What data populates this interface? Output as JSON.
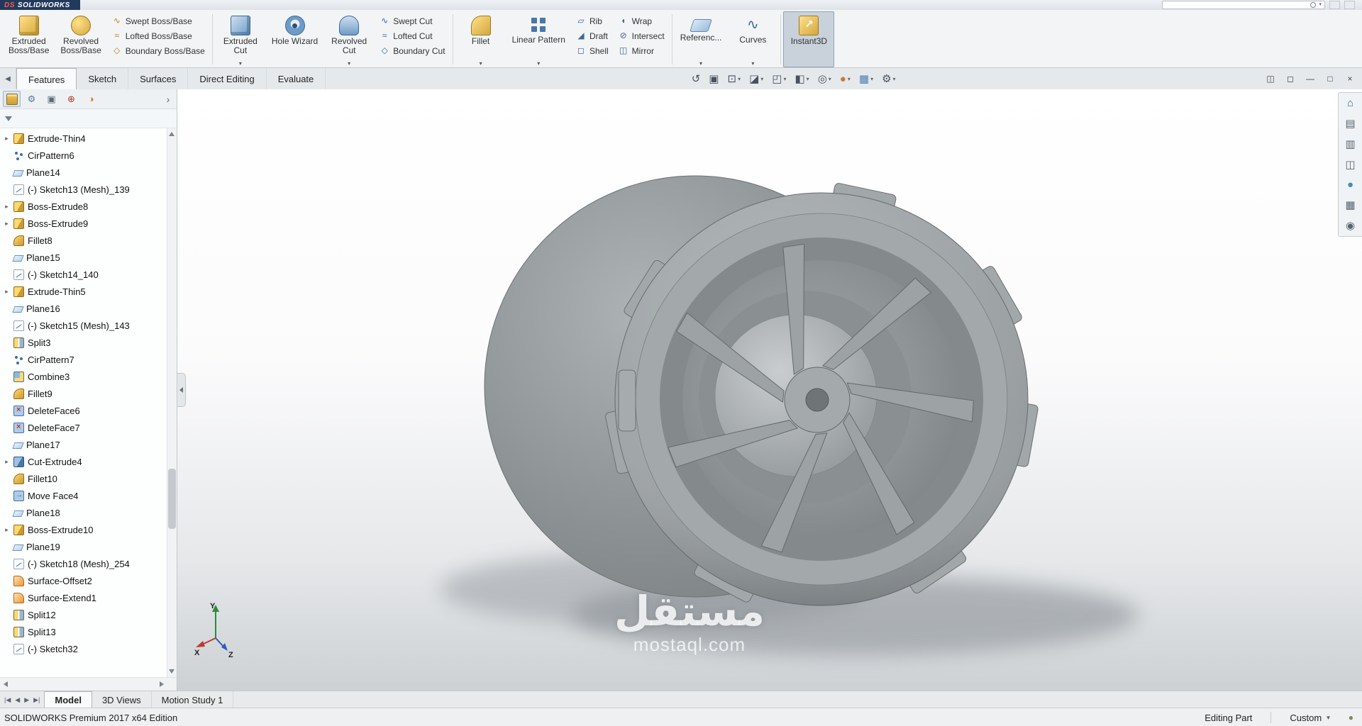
{
  "titlebar": {
    "logo_mark": "DS",
    "app_name": "SOLIDWORKS"
  },
  "glyphs": {
    "caret_down": "▾",
    "chevron_right": "›",
    "tree_expand": "▸"
  },
  "ribbon": {
    "groups": [
      {
        "buttons": [
          {
            "type": "large",
            "label": "Extruded\nBoss/Base",
            "icon": "extruded-boss"
          },
          {
            "type": "large",
            "label": "Revolved\nBoss/Base",
            "icon": "revolved-boss"
          },
          {
            "type": "stack",
            "items": [
              {
                "label": "Swept Boss/Base",
                "icon": "swept-boss"
              },
              {
                "label": "Lofted Boss/Base",
                "icon": "lofted-boss"
              },
              {
                "label": "Boundary Boss/Base",
                "icon": "boundary-boss"
              }
            ]
          }
        ]
      },
      {
        "buttons": [
          {
            "type": "large",
            "label": "Extruded\nCut",
            "icon": "extruded-cut",
            "dropdown": true
          },
          {
            "type": "large",
            "label": "Hole Wizard",
            "icon": "hole-wizard"
          },
          {
            "type": "large",
            "label": "Revolved\nCut",
            "icon": "revolved-cut",
            "dropdown": true
          },
          {
            "type": "stack",
            "items": [
              {
                "label": "Swept Cut",
                "icon": "swept-cut"
              },
              {
                "label": "Lofted Cut",
                "icon": "lofted-cut"
              },
              {
                "label": "Boundary Cut",
                "icon": "boundary-cut"
              }
            ]
          }
        ]
      },
      {
        "buttons": [
          {
            "type": "large",
            "label": "Fillet",
            "icon": "fillet",
            "dropdown": true
          },
          {
            "type": "large",
            "label": "Linear Pattern",
            "icon": "linear-pattern",
            "dropdown": true
          },
          {
            "type": "stack",
            "items": [
              {
                "label": "Rib",
                "icon": "rib"
              },
              {
                "label": "Draft",
                "icon": "draft"
              },
              {
                "label": "Shell",
                "icon": "shell"
              }
            ]
          },
          {
            "type": "stack",
            "items": [
              {
                "label": "Wrap",
                "icon": "wrap"
              },
              {
                "label": "Intersect",
                "icon": "intersect"
              },
              {
                "label": "Mirror",
                "icon": "mirror"
              }
            ]
          }
        ]
      },
      {
        "buttons": [
          {
            "type": "large",
            "label": "Referenc...",
            "icon": "reference",
            "dropdown": true
          },
          {
            "type": "large",
            "label": "Curves",
            "icon": "curves",
            "dropdown": true
          }
        ]
      },
      {
        "buttons": [
          {
            "type": "large",
            "label": "Instant3D",
            "icon": "instant3d",
            "active": true
          }
        ]
      }
    ]
  },
  "tabbar": {
    "back_glyph": "◀",
    "tabs": [
      "Features",
      "Sketch",
      "Surfaces",
      "Direct Editing",
      "Evaluate"
    ],
    "active_index": 0
  },
  "view_toolbar": {
    "icons": [
      {
        "name": "previous-view",
        "glyph": "↺"
      },
      {
        "name": "zoom-to-fit",
        "glyph": "▣"
      },
      {
        "name": "zoom-to-area",
        "glyph": "⊡",
        "dropdown": true
      },
      {
        "name": "section-view",
        "glyph": "◪",
        "dropdown": true
      },
      {
        "name": "view-orientation",
        "glyph": "◰",
        "dropdown": true
      },
      {
        "name": "display-style",
        "glyph": "◧",
        "dropdown": true
      },
      {
        "name": "hide-show-items",
        "glyph": "◎",
        "dropdown": true
      },
      {
        "name": "edit-appearance",
        "glyph": "●",
        "tint": "#c77b3a",
        "dropdown": true
      },
      {
        "name": "apply-scene",
        "glyph": "▦",
        "tint": "#4a7ab5",
        "dropdown": true
      },
      {
        "name": "view-settings",
        "glyph": "⚙",
        "dropdown": true
      }
    ]
  },
  "window_controls": {
    "buttons": [
      {
        "name": "task-pane-toggle",
        "glyph": "◫"
      },
      {
        "name": "display-pane-toggle",
        "glyph": "◻"
      },
      {
        "name": "minimize-button",
        "glyph": "—"
      },
      {
        "name": "restore-button",
        "glyph": "□"
      },
      {
        "name": "close-button",
        "glyph": "×"
      }
    ]
  },
  "left_panel": {
    "tabs": [
      {
        "name": "featuremanager-tab"
      },
      {
        "name": "propertymanager-tab",
        "glyph": "⚙",
        "color": "#5a7a9a"
      },
      {
        "name": "configurationmanager-tab",
        "glyph": "▣",
        "color": "#5a6a78"
      },
      {
        "name": "dimxpertmanager-tab",
        "glyph": "⊕",
        "color": "#b03a2e"
      },
      {
        "name": "displaymanager-tab",
        "glyph": "◑",
        "color": "#d07a28"
      }
    ],
    "tree": [
      {
        "label": "Extrude-Thin4",
        "icon": "extrude",
        "expand": true
      },
      {
        "label": "CirPattern6",
        "icon": "cirpattern"
      },
      {
        "label": "Plane14",
        "icon": "plane"
      },
      {
        "label": "(-) Sketch13 (Mesh)_139",
        "icon": "sketch"
      },
      {
        "label": "Boss-Extrude8",
        "icon": "extrude",
        "expand": true
      },
      {
        "label": "Boss-Extrude9",
        "icon": "extrude",
        "expand": true
      },
      {
        "label": "Fillet8",
        "icon": "fillet"
      },
      {
        "label": "Plane15",
        "icon": "plane"
      },
      {
        "label": "(-) Sketch14_140",
        "icon": "sketch"
      },
      {
        "label": "Extrude-Thin5",
        "icon": "extrude",
        "expand": true
      },
      {
        "label": "Plane16",
        "icon": "plane"
      },
      {
        "label": "(-) Sketch15 (Mesh)_143",
        "icon": "sketch"
      },
      {
        "label": "Split3",
        "icon": "split"
      },
      {
        "label": "CirPattern7",
        "icon": "cirpattern"
      },
      {
        "label": "Combine3",
        "icon": "combine"
      },
      {
        "label": "Fillet9",
        "icon": "fillet"
      },
      {
        "label": "DeleteFace6",
        "icon": "deleteface"
      },
      {
        "label": "DeleteFace7",
        "icon": "deleteface"
      },
      {
        "label": "Plane17",
        "icon": "plane"
      },
      {
        "label": "Cut-Extrude4",
        "icon": "cutextrude",
        "expand": true
      },
      {
        "label": "Fillet10",
        "icon": "fillet"
      },
      {
        "label": "Move Face4",
        "icon": "moveface"
      },
      {
        "label": "Plane18",
        "icon": "plane"
      },
      {
        "label": "Boss-Extrude10",
        "icon": "extrude",
        "expand": true
      },
      {
        "label": "Plane19",
        "icon": "plane"
      },
      {
        "label": "(-) Sketch18 (Mesh)_254",
        "icon": "sketch"
      },
      {
        "label": "Surface-Offset2",
        "icon": "surface"
      },
      {
        "label": "Surface-Extend1",
        "icon": "surface"
      },
      {
        "label": "Split12",
        "icon": "split"
      },
      {
        "label": "Split13",
        "icon": "split"
      },
      {
        "label": "(-) Sketch32",
        "icon": "sketch"
      }
    ]
  },
  "task_pane": {
    "icons": [
      {
        "name": "solidworks-resources",
        "glyph": "⌂",
        "color": "#3f6fa8"
      },
      {
        "name": "design-library",
        "glyph": "▤",
        "color": "#56636f"
      },
      {
        "name": "file-explorer",
        "glyph": "▥",
        "color": "#56636f"
      },
      {
        "name": "view-palette",
        "glyph": "◫",
        "color": "#56636f"
      },
      {
        "name": "appearances-scenes",
        "glyph": "●",
        "color": "#3f8fb5"
      },
      {
        "name": "custom-properties",
        "glyph": "▦",
        "color": "#56636f"
      },
      {
        "name": "forum",
        "glyph": "◉",
        "color": "#56636f"
      }
    ]
  },
  "bottom_bar": {
    "nav": [
      "|◀",
      "◀",
      "▶",
      "▶|"
    ],
    "tabs": [
      "Model",
      "3D Views",
      "Motion Study 1"
    ],
    "active_index": 0
  },
  "status_bar": {
    "left": "SOLIDWORKS Premium 2017 x64 Edition",
    "editing": "Editing Part",
    "units": "Custom",
    "status_glyph": "●"
  },
  "watermark": {
    "title": "مستقل",
    "domain": "mostaql.com"
  },
  "triad": {
    "x": "X",
    "y": "Y",
    "z": "Z"
  }
}
